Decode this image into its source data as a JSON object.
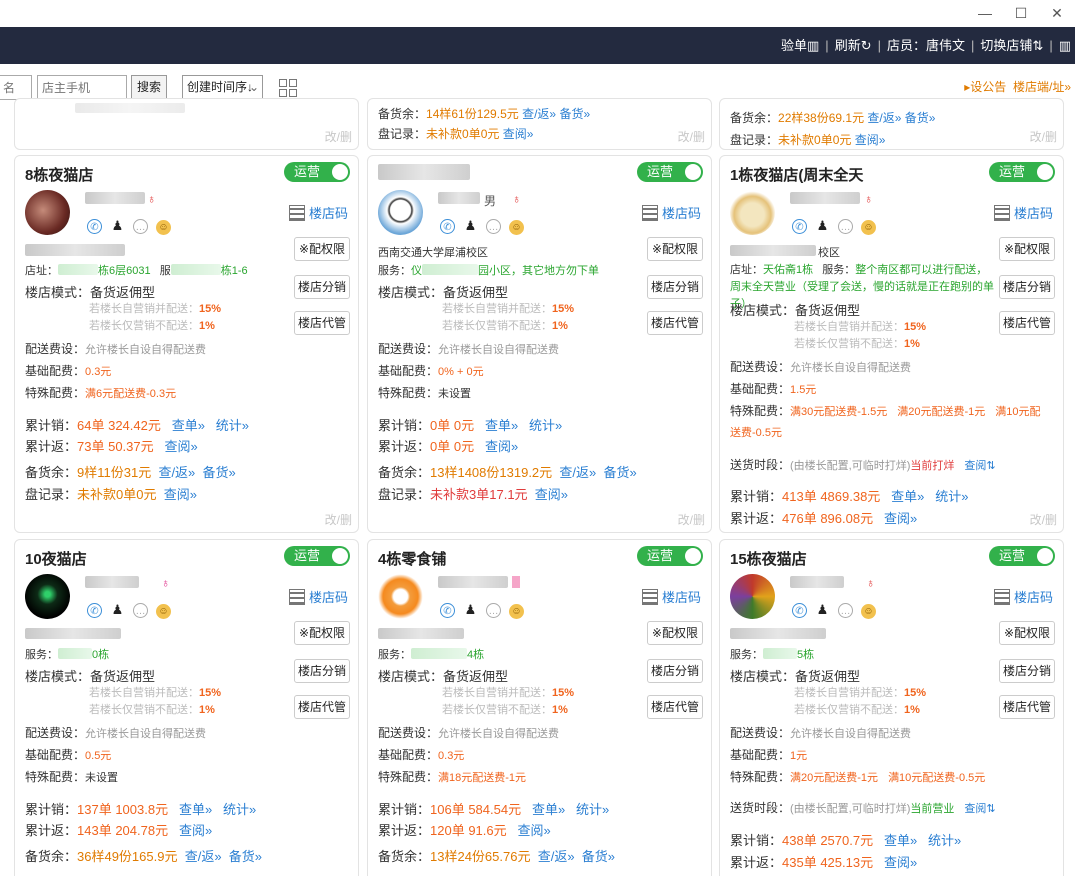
{
  "window": {
    "minimize": "—",
    "maximize": "☐",
    "close": "✕"
  },
  "topbar": {
    "verify": "验单▥",
    "refresh": "刷新↻",
    "clerk_label": "店员：",
    "clerk_name": "唐伟文",
    "switch_store": "切换店铺⇅",
    "book_icon": "▥"
  },
  "toolbar": {
    "name_input_placeholder": "名",
    "phone_input_placeholder": "店主手机",
    "search_label": "搜索",
    "sort_selected": "创建时间序↓",
    "notice_icon": "▸",
    "notice_label": "设公告",
    "store_side_link": "楼店端/址»"
  },
  "common": {
    "qrcode_label": "楼店码",
    "perm_btn": "※配权限",
    "distribute_btn": "楼店分销",
    "manage_btn": "楼店代管",
    "mode_label": "楼店模式：",
    "mode_value": "备货返佣型",
    "rule1_label": "若楼长自营销并配送：",
    "rule2_label": "若楼长仅营销不配送：",
    "fee_set_label": "配送费设：",
    "fee_set_value": "允许楼长自设自得配送费",
    "base_fee_label": "基础配费：",
    "special_fee_label": "特殊配费：",
    "sales_label": "累计销：",
    "rebate_label": "累计返：",
    "stock_label": "备货余：",
    "check_label": "盘记录：",
    "query_order": "查单»",
    "stats": "统计»",
    "query": "查阅»",
    "query_return": "查/返»",
    "restock": "备货»",
    "edit": "改/删",
    "delivery_time_label": "送货时段：",
    "delivery_time_hint": "(由楼长配置,可临时打烊)",
    "query_updown": "查阅⇅",
    "status_toggle": "运营",
    "address_label": "店址：",
    "service_label": "服务：",
    "bag_icon": "♁"
  },
  "partial_top": {
    "mid_stock": "14样61份129.5元",
    "right_stock": "22样38份69.1元",
    "right_check": "未补款0单0元",
    "mid_check": "未补款0单0元"
  },
  "cards": [
    {
      "name": "8栋夜猫店",
      "address_suffix": "栋6层6031",
      "service_prefix": "服",
      "service_suffix": "栋1-6",
      "rule1": "15%",
      "rule2": "1%",
      "base_fee": "0.3元",
      "special_fee": "满6元配送费-0.3元",
      "sales": "64单 324.42元",
      "rebate": "73单 50.37元",
      "stock": "9样11份31元",
      "check": "未补款0单0元"
    },
    {
      "name": "",
      "gender": "男",
      "school": "西南交通大学犀浦校区",
      "service_prefix": "仪",
      "service_suffix": "园小区，其它地方勿下单",
      "rule1": "15%",
      "rule2": "1%",
      "base_fee": "0% + 0元",
      "special_fee": "未设置",
      "sales": "0单 0元",
      "rebate": "0单 0元",
      "stock": "13样1408份1319.2元",
      "check": "未补款3单17.1元"
    },
    {
      "name": "1栋夜猫店(周末全天",
      "school_suffix": "校区",
      "address": "天佑斋1栋",
      "service_text": "整个南区都可以进行配送，周末全天营业（受理了会送，慢的话就是正在跑别的单子）",
      "rule1": "15%",
      "rule2": "1%",
      "base_fee": "1.5元",
      "special_fee_a": "满30元配送费-1.5元",
      "special_fee_b": "满20元配送费-1元",
      "special_fee_c": "满10元配",
      "special_fee_d": "送费-0.5元",
      "delivery_state": "当前打烊",
      "sales": "413单 4869.38元",
      "rebate": "476单 896.08元"
    },
    {
      "name": "10夜猫店",
      "service_suffix": "0栋",
      "rule1": "15%",
      "rule2": "1%",
      "base_fee": "0.5元",
      "special_fee": "未设置",
      "sales": "137单 1003.8元",
      "rebate": "143单 204.78元",
      "stock": "36样49份165.9元"
    },
    {
      "name": "4栋零食铺",
      "service_suffix": "4栋",
      "rule1": "15%",
      "rule2": "1%",
      "base_fee": "0.3元",
      "special_fee": "满18元配送费-1元",
      "sales": "106单 584.54元",
      "rebate": "120单 91.6元",
      "stock": "13样24份65.76元"
    },
    {
      "name": "15栋夜猫店",
      "service_suffix": "5栋",
      "rule1": "15%",
      "rule2": "1%",
      "base_fee": "1元",
      "special_fee_a": "满20元配送费-1元",
      "special_fee_b": "满10元配送费-0.5元",
      "delivery_state": "当前营业",
      "sales": "438单 2570.7元",
      "rebate": "435单 425.13元"
    }
  ]
}
